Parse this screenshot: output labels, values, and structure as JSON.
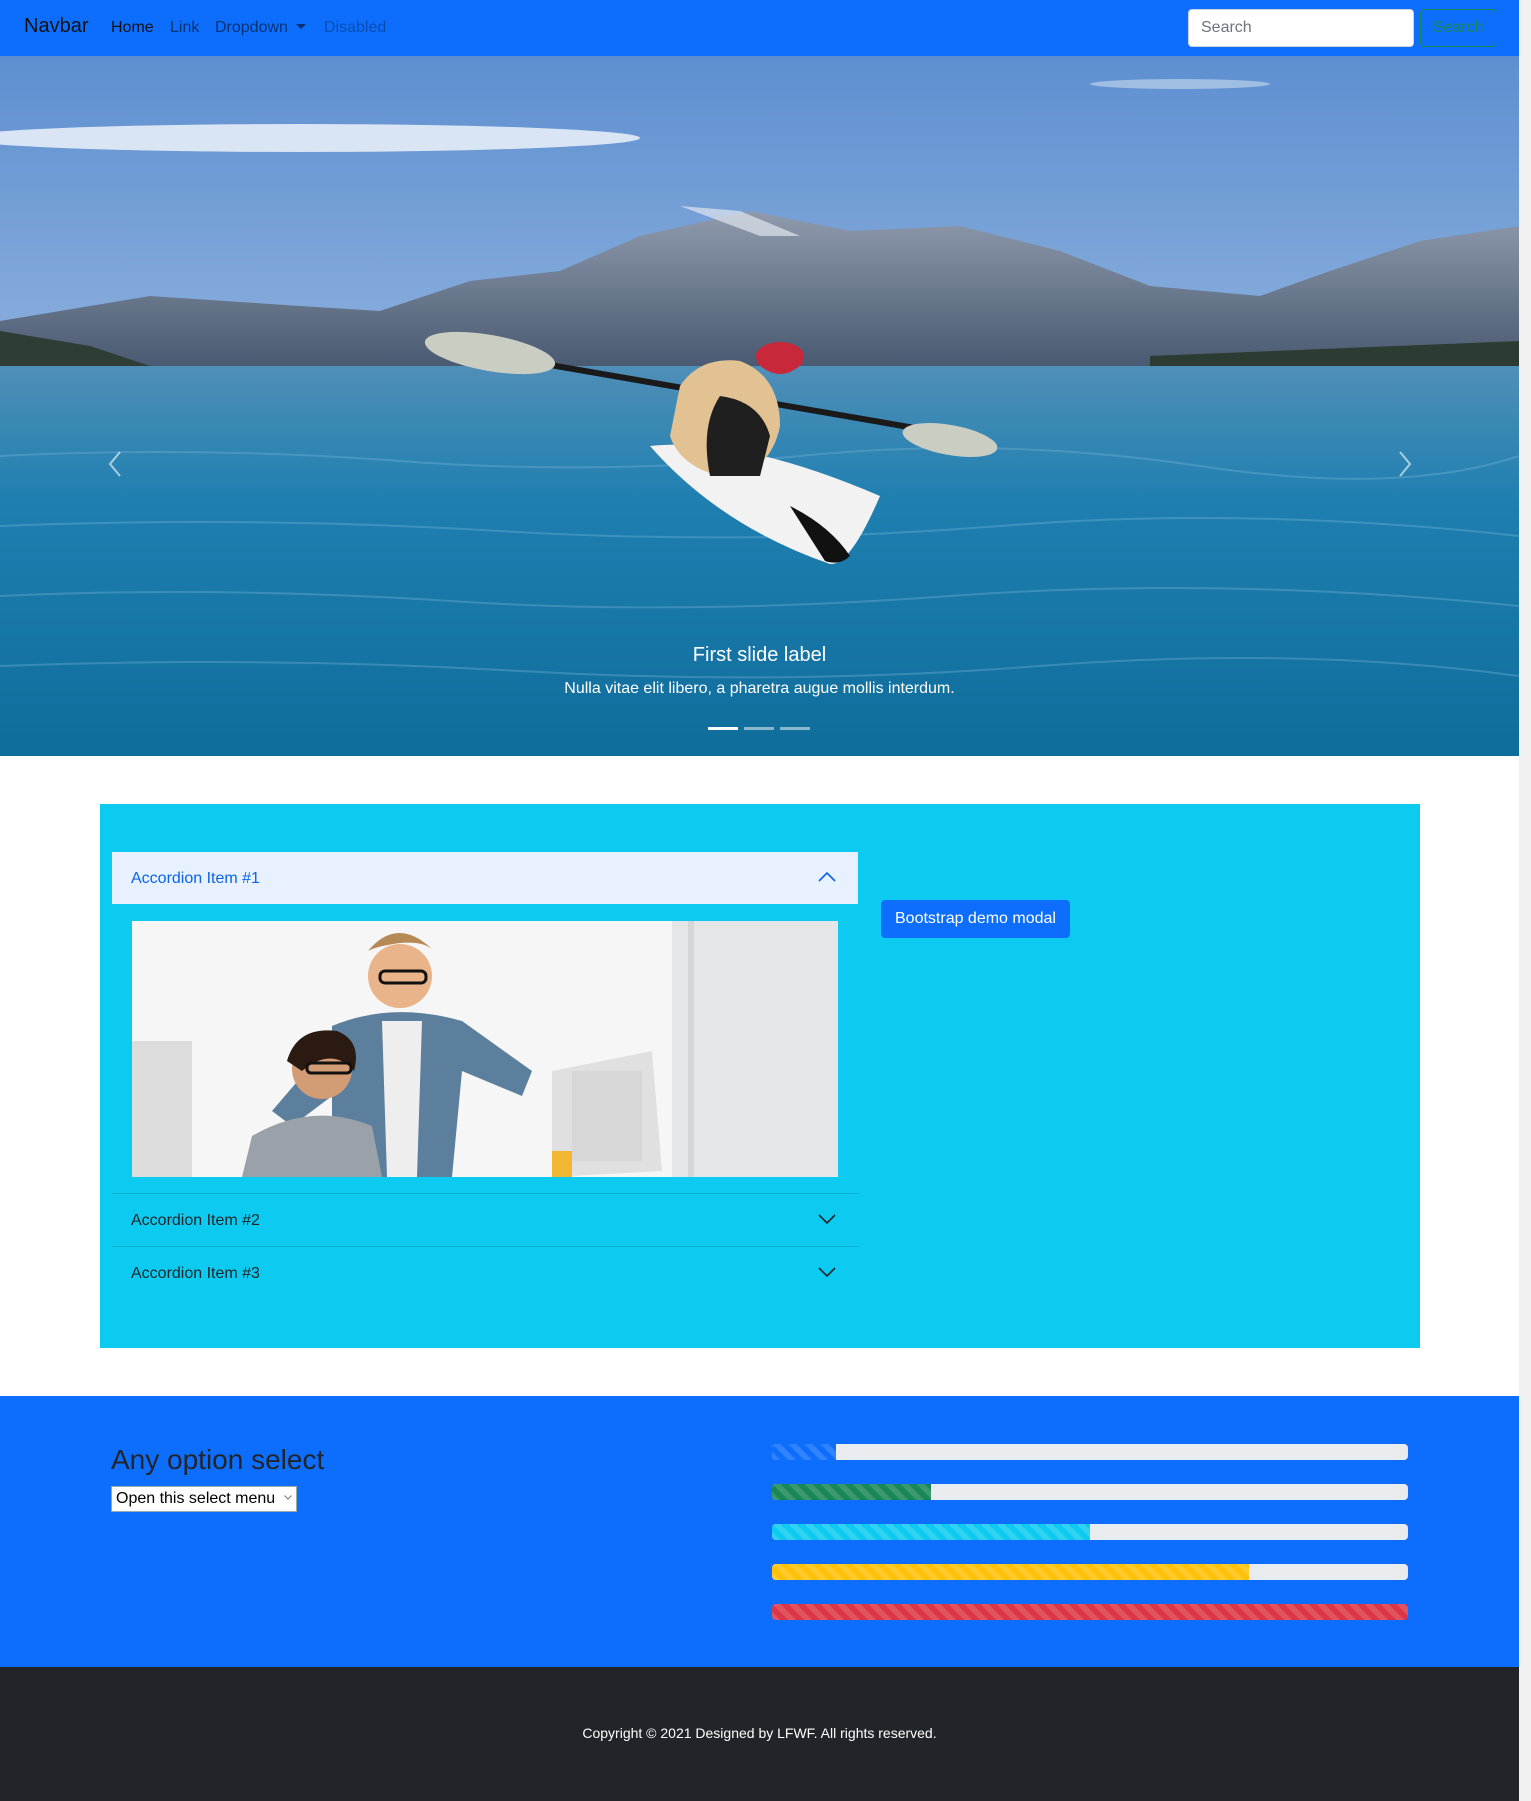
{
  "navbar": {
    "brand": "Navbar",
    "links": [
      "Home",
      "Link",
      "Dropdown",
      "Disabled"
    ],
    "search_placeholder": "Search",
    "search_button": "Search"
  },
  "carousel": {
    "caption_title": "First slide label",
    "caption_text": "Nulla vitae elit libero, a pharetra augue mollis interdum.",
    "indicator_count": 3,
    "active_index": 0
  },
  "accordion": {
    "items": [
      {
        "title": "Accordion Item #1",
        "expanded": true
      },
      {
        "title": "Accordion Item #2",
        "expanded": false
      },
      {
        "title": "Accordion Item #3",
        "expanded": false
      }
    ]
  },
  "modal_button": "Bootstrap demo modal",
  "options": {
    "title": "Any option select",
    "select_value": "Open this select menu"
  },
  "progress_bars": [
    {
      "percent": 10,
      "color": "#0d6efd"
    },
    {
      "percent": 25,
      "color": "#198754"
    },
    {
      "percent": 50,
      "color": "#0dcaf0"
    },
    {
      "percent": 75,
      "color": "#ffc107"
    },
    {
      "percent": 100,
      "color": "#dc3545"
    }
  ],
  "footer": {
    "copyright": "Copyright © 2021 Designed by LFWF. All rights reserved."
  },
  "colors": {
    "primary": "#0d6efd",
    "info": "#0dcaf0",
    "dark": "#212529"
  }
}
